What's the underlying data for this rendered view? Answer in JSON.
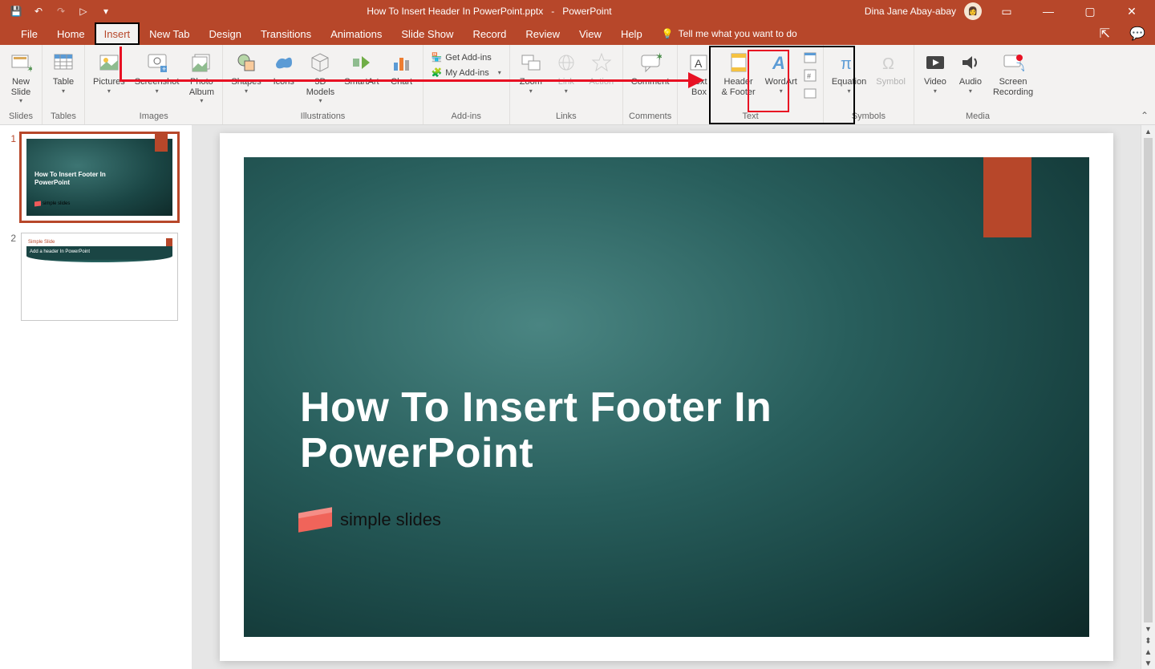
{
  "titlebar": {
    "filename": "How To Insert Header In PowerPoint.pptx",
    "app": "PowerPoint",
    "user": "Dina Jane Abay-abay"
  },
  "qat": {
    "save": "💾",
    "undo": "↶",
    "redo": "↷",
    "start": "▷",
    "more": "▾"
  },
  "window": {
    "ribbon_opts": "▭",
    "min": "—",
    "max": "▢",
    "close": "✕"
  },
  "tabs": {
    "file": "File",
    "home": "Home",
    "insert": "Insert",
    "newtab": "New Tab",
    "design": "Design",
    "transitions": "Transitions",
    "animations": "Animations",
    "slideshow": "Slide Show",
    "record": "Record",
    "review": "Review",
    "view": "View",
    "help": "Help",
    "tellme": "Tell me what you want to do"
  },
  "ribbon": {
    "slides": {
      "new_slide": "New\nSlide",
      "label": "Slides"
    },
    "tables": {
      "table": "Table",
      "label": "Tables"
    },
    "images": {
      "pictures": "Pictures",
      "screenshot": "Screenshot",
      "photo_album": "Photo\nAlbum",
      "label": "Images"
    },
    "illustrations": {
      "shapes": "Shapes",
      "icons": "Icons",
      "models": "3D\nModels",
      "smartart": "SmartArt",
      "chart": "Chart",
      "label": "Illustrations"
    },
    "addins": {
      "get": "Get Add-ins",
      "my": "My Add-ins",
      "label": "Add-ins"
    },
    "links": {
      "zoom": "Zoom",
      "link": "Link",
      "action": "Action",
      "label": "Links"
    },
    "comments": {
      "comment": "Comment",
      "label": "Comments"
    },
    "text": {
      "textbox": "Text\nBox",
      "header_footer": "Header\n& Footer",
      "wordart": "WordArt",
      "label": "Text"
    },
    "symbols": {
      "equation": "Equation",
      "symbol": "Symbol",
      "label": "Symbols"
    },
    "media": {
      "video": "Video",
      "audio": "Audio",
      "screen": "Screen\nRecording",
      "label": "Media"
    }
  },
  "thumbs": {
    "n1": "1",
    "n2": "2",
    "t1_title": "How To Insert Footer In\nPowerPoint",
    "t1_logo": "simple slides",
    "t2_hdr": "Simple Slide",
    "t2_body": "Add a header In PowerPoint"
  },
  "slide": {
    "title": "How To Insert Footer In\nPowerPoint",
    "logo": "simple slides"
  }
}
